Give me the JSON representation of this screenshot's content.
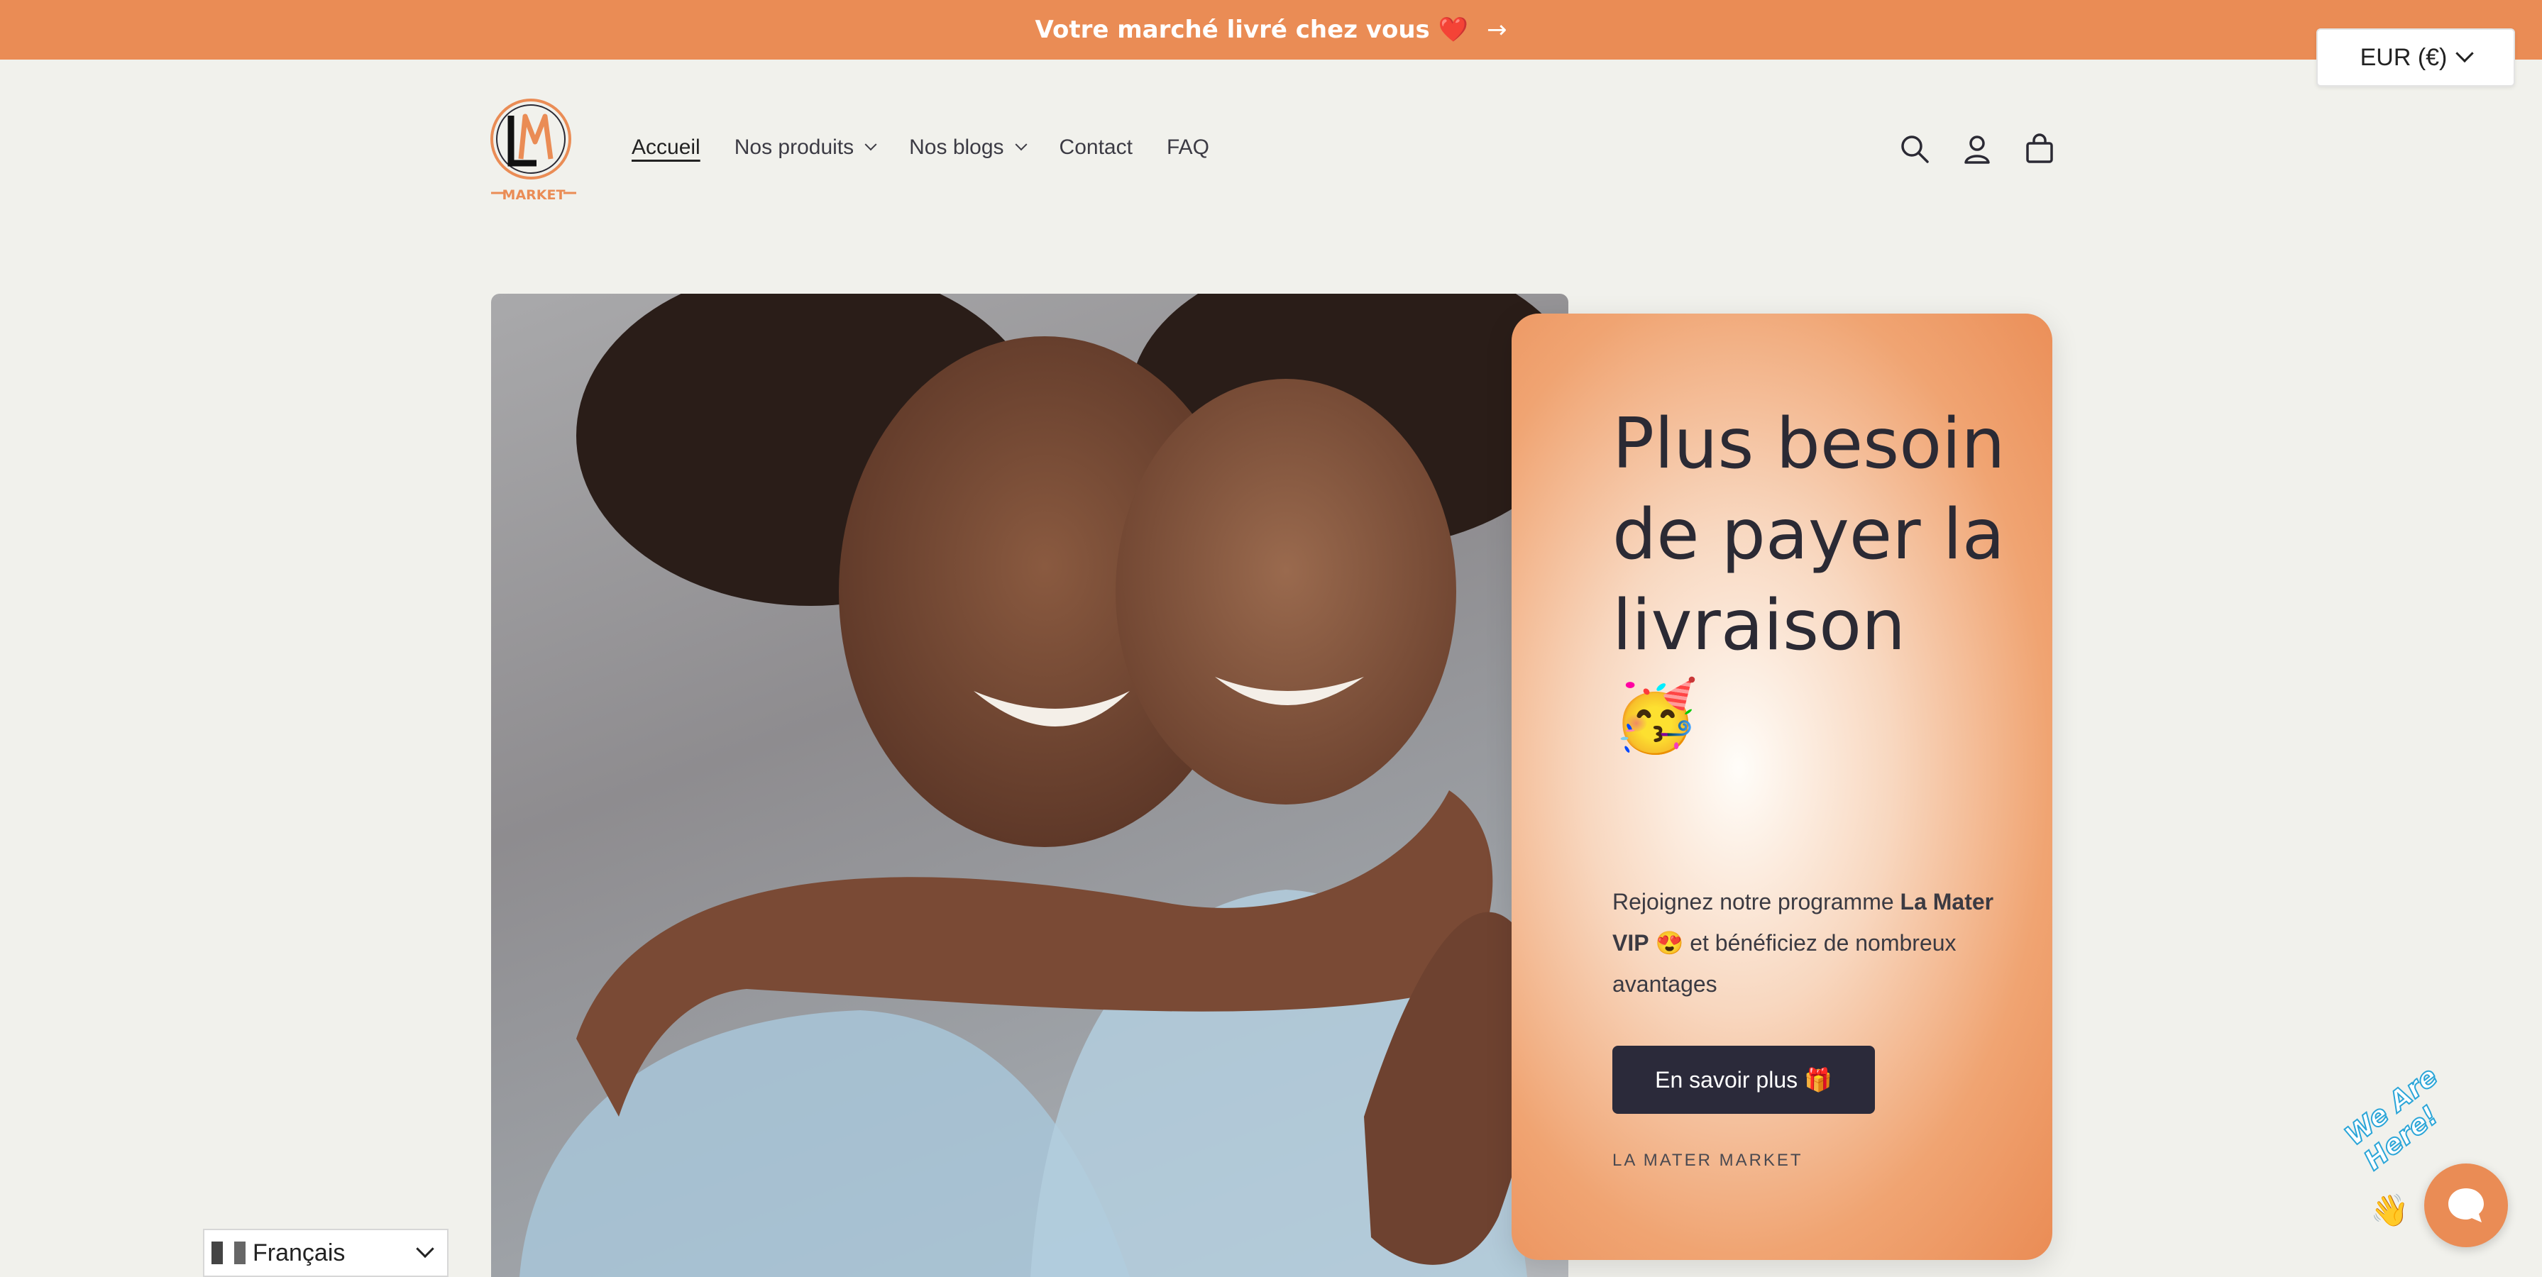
{
  "announcement": {
    "text": "Votre marché livré chez vous ❤️",
    "arrow": "→"
  },
  "currency": {
    "label": "EUR (€)"
  },
  "logo": {
    "text": "MARKET"
  },
  "nav": {
    "items": [
      {
        "label": "Accueil",
        "active": true,
        "dropdown": false
      },
      {
        "label": "Nos produits",
        "active": false,
        "dropdown": true
      },
      {
        "label": "Nos blogs",
        "active": false,
        "dropdown": true
      },
      {
        "label": "Contact",
        "active": false,
        "dropdown": false
      },
      {
        "label": "FAQ",
        "active": false,
        "dropdown": false
      }
    ]
  },
  "header_icons": [
    "search-icon",
    "account-icon",
    "cart-icon"
  ],
  "hero": {
    "title": "Plus besoin de payer la livraison 🥳",
    "text_before": "Rejoignez notre programme ",
    "text_bold": "La Mater VIP",
    "text_after": " 😍 et bénéficiez de nombreux avantages",
    "button": "En savoir plus 🎁",
    "caption": "LA MATER MARKET"
  },
  "language": {
    "selected": "Français"
  },
  "chat": {
    "badge": "We Are Here!",
    "emoji": "👋"
  },
  "colors": {
    "accent": "#ea8c55",
    "dark": "#2b2a3a",
    "background": "#f1f1ec"
  }
}
